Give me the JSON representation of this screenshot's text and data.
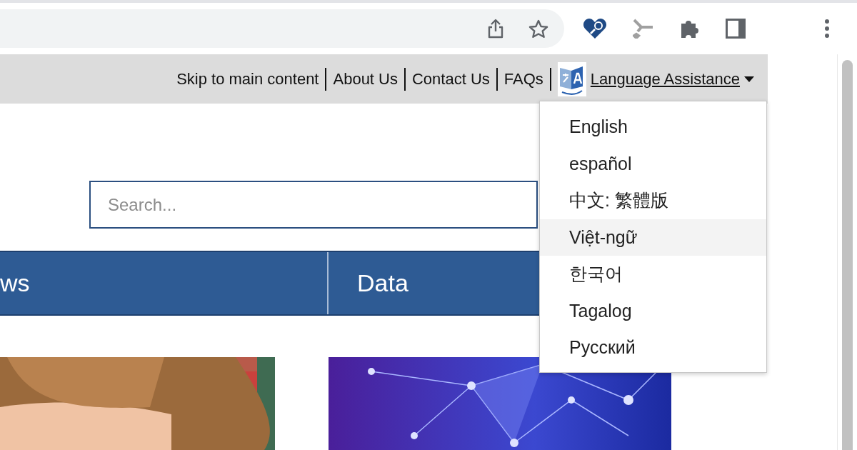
{
  "utility_nav": {
    "links": [
      "Skip to main content",
      "About Us",
      "Contact Us",
      "FAQs"
    ],
    "language_menu": {
      "label": "Language Assistance",
      "expanded": true,
      "options": [
        {
          "label": "English",
          "selected": false
        },
        {
          "label": "español",
          "selected": false
        },
        {
          "label": "中文: 繁體版",
          "selected": false
        },
        {
          "label": "Việt-ngữ",
          "selected": true
        },
        {
          "label": "한국어",
          "selected": false
        },
        {
          "label": "Tagalog",
          "selected": false
        },
        {
          "label": "Русский",
          "selected": false
        }
      ]
    }
  },
  "search": {
    "placeholder": "Search..."
  },
  "main_nav": {
    "items": [
      "ws",
      "Data"
    ]
  }
}
